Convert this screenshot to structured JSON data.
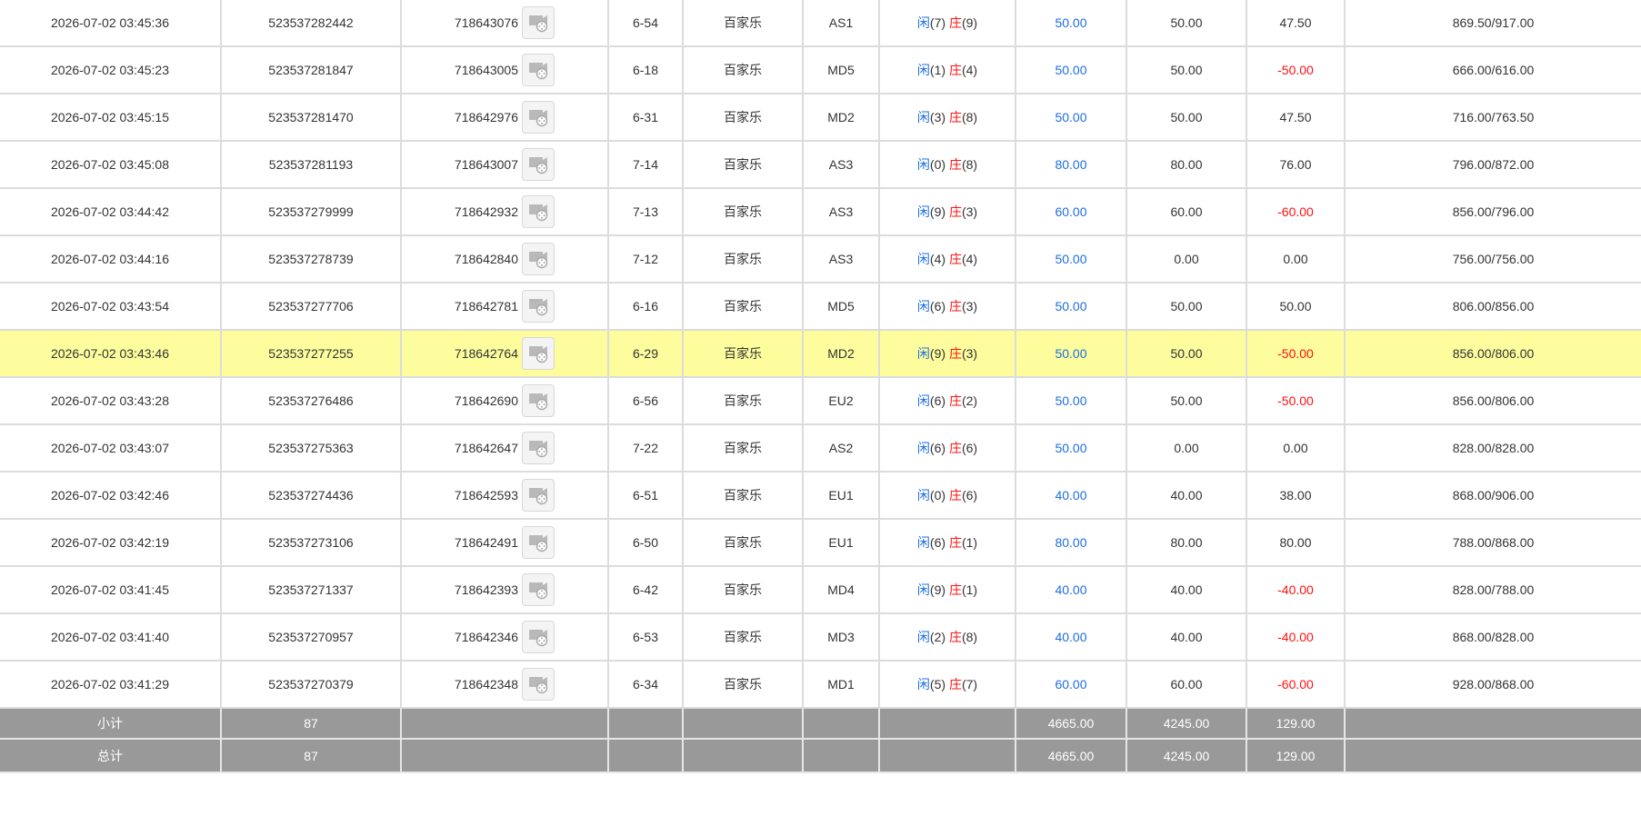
{
  "colors": {
    "player": "#1b6fe0",
    "banker": "#ff1010",
    "negative": "#ff1010",
    "bet": "#1b6fe0",
    "highlight": "#fdfd9e",
    "summary_bg": "#999999"
  },
  "icons": {
    "replay": "video-replay-icon"
  },
  "rows": [
    {
      "time": "2026-07-02 03:45:36",
      "bet_id": "523537282442",
      "round_id": "718643076",
      "shoe": "6-54",
      "game": "百家乐",
      "table": "AS1",
      "player_label": "闲",
      "player_pts": "(7)",
      "banker_label": "庄",
      "banker_pts": "(9)",
      "bet": "50.00",
      "valid": "50.00",
      "win": "47.50",
      "win_negative": false,
      "balance": "869.50/917.00",
      "highlight": false
    },
    {
      "time": "2026-07-02 03:45:23",
      "bet_id": "523537281847",
      "round_id": "718643005",
      "shoe": "6-18",
      "game": "百家乐",
      "table": "MD5",
      "player_label": "闲",
      "player_pts": "(1)",
      "banker_label": "庄",
      "banker_pts": "(4)",
      "bet": "50.00",
      "valid": "50.00",
      "win": "-50.00",
      "win_negative": true,
      "balance": "666.00/616.00",
      "highlight": false
    },
    {
      "time": "2026-07-02 03:45:15",
      "bet_id": "523537281470",
      "round_id": "718642976",
      "shoe": "6-31",
      "game": "百家乐",
      "table": "MD2",
      "player_label": "闲",
      "player_pts": "(3)",
      "banker_label": "庄",
      "banker_pts": "(8)",
      "bet": "50.00",
      "valid": "50.00",
      "win": "47.50",
      "win_negative": false,
      "balance": "716.00/763.50",
      "highlight": false
    },
    {
      "time": "2026-07-02 03:45:08",
      "bet_id": "523537281193",
      "round_id": "718643007",
      "shoe": "7-14",
      "game": "百家乐",
      "table": "AS3",
      "player_label": "闲",
      "player_pts": "(0)",
      "banker_label": "庄",
      "banker_pts": "(8)",
      "bet": "80.00",
      "valid": "80.00",
      "win": "76.00",
      "win_negative": false,
      "balance": "796.00/872.00",
      "highlight": false
    },
    {
      "time": "2026-07-02 03:44:42",
      "bet_id": "523537279999",
      "round_id": "718642932",
      "shoe": "7-13",
      "game": "百家乐",
      "table": "AS3",
      "player_label": "闲",
      "player_pts": "(9)",
      "banker_label": "庄",
      "banker_pts": "(3)",
      "bet": "60.00",
      "valid": "60.00",
      "win": "-60.00",
      "win_negative": true,
      "balance": "856.00/796.00",
      "highlight": false
    },
    {
      "time": "2026-07-02 03:44:16",
      "bet_id": "523537278739",
      "round_id": "718642840",
      "shoe": "7-12",
      "game": "百家乐",
      "table": "AS3",
      "player_label": "闲",
      "player_pts": "(4)",
      "banker_label": "庄",
      "banker_pts": "(4)",
      "bet": "50.00",
      "valid": "0.00",
      "win": "0.00",
      "win_negative": false,
      "balance": "756.00/756.00",
      "highlight": false
    },
    {
      "time": "2026-07-02 03:43:54",
      "bet_id": "523537277706",
      "round_id": "718642781",
      "shoe": "6-16",
      "game": "百家乐",
      "table": "MD5",
      "player_label": "闲",
      "player_pts": "(6)",
      "banker_label": "庄",
      "banker_pts": "(3)",
      "bet": "50.00",
      "valid": "50.00",
      "win": "50.00",
      "win_negative": false,
      "balance": "806.00/856.00",
      "highlight": false
    },
    {
      "time": "2026-07-02 03:43:46",
      "bet_id": "523537277255",
      "round_id": "718642764",
      "shoe": "6-29",
      "game": "百家乐",
      "table": "MD2",
      "player_label": "闲",
      "player_pts": "(9)",
      "banker_label": "庄",
      "banker_pts": "(3)",
      "bet": "50.00",
      "valid": "50.00",
      "win": "-50.00",
      "win_negative": true,
      "balance": "856.00/806.00",
      "highlight": true
    },
    {
      "time": "2026-07-02 03:43:28",
      "bet_id": "523537276486",
      "round_id": "718642690",
      "shoe": "6-56",
      "game": "百家乐",
      "table": "EU2",
      "player_label": "闲",
      "player_pts": "(6)",
      "banker_label": "庄",
      "banker_pts": "(2)",
      "bet": "50.00",
      "valid": "50.00",
      "win": "-50.00",
      "win_negative": true,
      "balance": "856.00/806.00",
      "highlight": false
    },
    {
      "time": "2026-07-02 03:43:07",
      "bet_id": "523537275363",
      "round_id": "718642647",
      "shoe": "7-22",
      "game": "百家乐",
      "table": "AS2",
      "player_label": "闲",
      "player_pts": "(6)",
      "banker_label": "庄",
      "banker_pts": "(6)",
      "bet": "50.00",
      "valid": "0.00",
      "win": "0.00",
      "win_negative": false,
      "balance": "828.00/828.00",
      "highlight": false
    },
    {
      "time": "2026-07-02 03:42:46",
      "bet_id": "523537274436",
      "round_id": "718642593",
      "shoe": "6-51",
      "game": "百家乐",
      "table": "EU1",
      "player_label": "闲",
      "player_pts": "(0)",
      "banker_label": "庄",
      "banker_pts": "(6)",
      "bet": "40.00",
      "valid": "40.00",
      "win": "38.00",
      "win_negative": false,
      "balance": "868.00/906.00",
      "highlight": false
    },
    {
      "time": "2026-07-02 03:42:19",
      "bet_id": "523537273106",
      "round_id": "718642491",
      "shoe": "6-50",
      "game": "百家乐",
      "table": "EU1",
      "player_label": "闲",
      "player_pts": "(6)",
      "banker_label": "庄",
      "banker_pts": "(1)",
      "bet": "80.00",
      "valid": "80.00",
      "win": "80.00",
      "win_negative": false,
      "balance": "788.00/868.00",
      "highlight": false
    },
    {
      "time": "2026-07-02 03:41:45",
      "bet_id": "523537271337",
      "round_id": "718642393",
      "shoe": "6-42",
      "game": "百家乐",
      "table": "MD4",
      "player_label": "闲",
      "player_pts": "(9)",
      "banker_label": "庄",
      "banker_pts": "(1)",
      "bet": "40.00",
      "valid": "40.00",
      "win": "-40.00",
      "win_negative": true,
      "balance": "828.00/788.00",
      "highlight": false
    },
    {
      "time": "2026-07-02 03:41:40",
      "bet_id": "523537270957",
      "round_id": "718642346",
      "shoe": "6-53",
      "game": "百家乐",
      "table": "MD3",
      "player_label": "闲",
      "player_pts": "(2)",
      "banker_label": "庄",
      "banker_pts": "(8)",
      "bet": "40.00",
      "valid": "40.00",
      "win": "-40.00",
      "win_negative": true,
      "balance": "868.00/828.00",
      "highlight": false
    },
    {
      "time": "2026-07-02 03:41:29",
      "bet_id": "523537270379",
      "round_id": "718642348",
      "shoe": "6-34",
      "game": "百家乐",
      "table": "MD1",
      "player_label": "闲",
      "player_pts": "(5)",
      "banker_label": "庄",
      "banker_pts": "(7)",
      "bet": "60.00",
      "valid": "60.00",
      "win": "-60.00",
      "win_negative": true,
      "balance": "928.00/868.00",
      "highlight": false
    }
  ],
  "subtotal": {
    "label": "小计",
    "count": "87",
    "bet": "4665.00",
    "valid": "4245.00",
    "win": "129.00"
  },
  "total": {
    "label": "总计",
    "count": "87",
    "bet": "4665.00",
    "valid": "4245.00",
    "win": "129.00"
  }
}
